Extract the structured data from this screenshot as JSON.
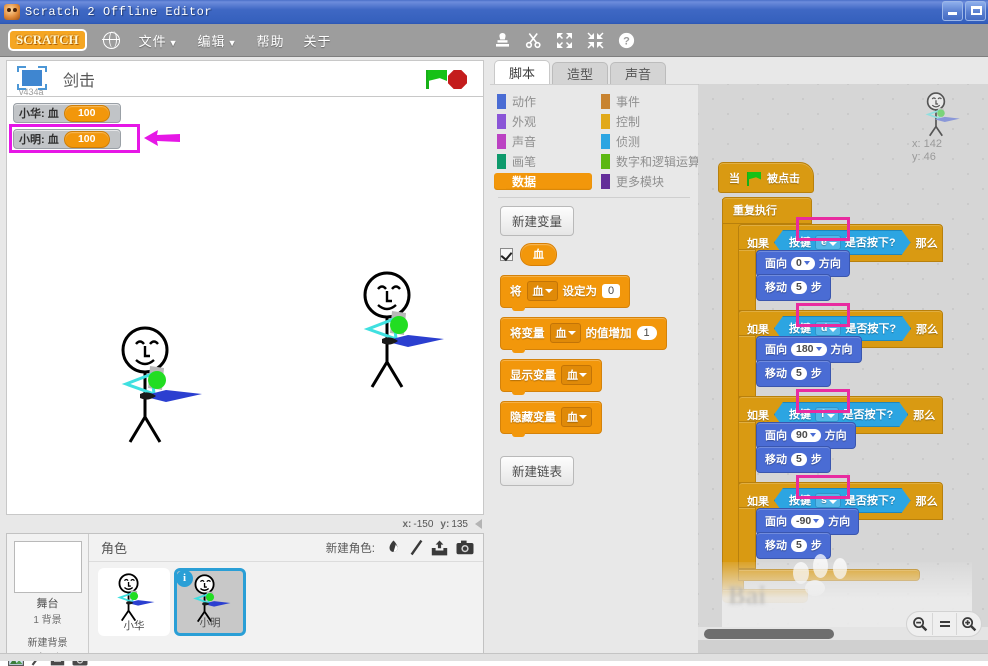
{
  "window": {
    "title": "Scratch 2 Offline Editor",
    "minimize_label": "_",
    "maximize_label": "□"
  },
  "menubar": {
    "logo": "SCRATCH",
    "globe_icon": "globe-icon",
    "items": [
      {
        "label": "文件",
        "caret": "▼"
      },
      {
        "label": "编辑",
        "caret": "▼"
      },
      {
        "label": "帮助",
        "caret": ""
      },
      {
        "label": "关于",
        "caret": ""
      }
    ],
    "tools": [
      {
        "name": "stamp-icon"
      },
      {
        "name": "scissors-icon"
      },
      {
        "name": "grow-icon"
      },
      {
        "name": "shrink-icon"
      },
      {
        "name": "help-icon"
      }
    ]
  },
  "stage_header": {
    "version": "v434a",
    "project_title": "剑击",
    "green_flag": "green-flag-icon",
    "stop": "stop-icon"
  },
  "stage": {
    "watchers": [
      {
        "name": "小华: 血",
        "value": "100"
      },
      {
        "name": "小明: 血",
        "value": "100"
      }
    ],
    "highlight_color": "#e617e6",
    "mouse_coords": {
      "x_label": "x:",
      "x": "-150",
      "y_label": "y:",
      "y": "135"
    }
  },
  "sprite_pane": {
    "stage_label": "舞台",
    "stage_sublabel": "1 背景",
    "new_backdrop_label": "新建背景",
    "backdrop_icons": [
      "library-icon",
      "paint-icon",
      "upload-icon",
      "camera-icon"
    ],
    "sprites_header": "角色",
    "new_sprite_label": "新建角色:",
    "new_sprite_icons": [
      "library-icon",
      "paint-icon",
      "upload-icon",
      "camera-icon"
    ],
    "sprites": [
      {
        "name": "小华",
        "selected": false
      },
      {
        "name": "小明",
        "selected": true,
        "badge": "i"
      }
    ]
  },
  "tabs": [
    {
      "label": "脚本",
      "active": true
    },
    {
      "label": "造型",
      "active": false
    },
    {
      "label": "声音",
      "active": false
    }
  ],
  "palette": {
    "categories": [
      {
        "label": "动作",
        "color": "#4a6cd4",
        "selected": false
      },
      {
        "label": "事件",
        "color": "#c88330",
        "selected": false
      },
      {
        "label": "外观",
        "color": "#8a55d7",
        "selected": false
      },
      {
        "label": "控制",
        "color": "#e1a91a",
        "selected": false
      },
      {
        "label": "声音",
        "color": "#bb42c3",
        "selected": false
      },
      {
        "label": "侦测",
        "color": "#2ca5e2",
        "selected": false
      },
      {
        "label": "画笔",
        "color": "#0e9a6c",
        "selected": false
      },
      {
        "label": "数字和逻辑运算",
        "color": "#5cb712",
        "selected": false
      },
      {
        "label": "数据",
        "color": "#f2970b",
        "selected": true
      },
      {
        "label": "更多模块",
        "color": "#632d99",
        "selected": false
      }
    ],
    "new_variable_button": "新建变量",
    "variable_name": "血",
    "variable_checked": true,
    "blocks": [
      {
        "type": "set",
        "pre": "将",
        "var": "血",
        "mid": "设定为",
        "value": "0"
      },
      {
        "type": "change",
        "pre": "将变量",
        "var": "血",
        "mid": "的值增加",
        "value": "1"
      },
      {
        "type": "show",
        "pre": "显示变量",
        "var": "血"
      },
      {
        "type": "hide",
        "pre": "隐藏变量",
        "var": "血"
      }
    ],
    "new_list_button": "新建链表"
  },
  "script": {
    "sprite_info": {
      "x_label": "x:",
      "x": "142",
      "y_label": "y:",
      "y": "46"
    },
    "hat": {
      "pre": "当",
      "post": "被点击"
    },
    "forever": "重复执行",
    "if_label": "如果",
    "then_label": "那么",
    "sense_pre": "按键",
    "sense_post": "是否按下?",
    "point_pre": "面向",
    "point_post": "方向",
    "move_pre": "移动",
    "move_post": "步",
    "branches": [
      {
        "key": "e",
        "direction": "0",
        "steps": "5"
      },
      {
        "key": "d",
        "direction": "180",
        "steps": "5"
      },
      {
        "key": "f",
        "direction": "90",
        "steps": "5"
      },
      {
        "key": "s",
        "direction": "-90",
        "steps": "5"
      }
    ],
    "highlight_color": "#e82ba0",
    "watermark_text": "Bai"
  },
  "zoom_controls": {
    "zoom_out": "zoom-out-icon",
    "reset": "zoom-reset-icon",
    "zoom_in": "zoom-in-icon"
  }
}
